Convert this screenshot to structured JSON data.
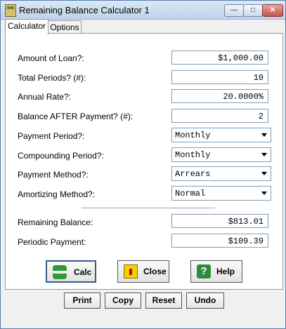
{
  "window": {
    "title": "Remaining Balance Calculator 1"
  },
  "tabs": [
    {
      "label": "Calculator"
    },
    {
      "label": "Options"
    }
  ],
  "inputs": {
    "amount_of_loan": {
      "label": "Amount of Loan?:",
      "value": "$1,000.00"
    },
    "total_periods": {
      "label": "Total Periods? (#):",
      "value": "10"
    },
    "annual_rate": {
      "label": "Annual Rate?:",
      "value": "20.0000%"
    },
    "balance_after_payment": {
      "label": "Balance AFTER Payment? (#):",
      "value": "2"
    }
  },
  "selects": {
    "payment_period": {
      "label": "Payment Period?:",
      "value": "Monthly"
    },
    "compounding_period": {
      "label": "Compounding Period?:",
      "value": "Monthly"
    },
    "payment_method": {
      "label": "Payment Method?:",
      "value": "Arrears"
    },
    "amortizing_method": {
      "label": "Amortizing Method?:",
      "value": "Normal"
    }
  },
  "results": {
    "remaining_balance": {
      "label": "Remaining Balance:",
      "value": "$813.01"
    },
    "periodic_payment": {
      "label": "Periodic Payment:",
      "value": "$109.39"
    }
  },
  "buttons": {
    "calc": "Calc",
    "close": "Close",
    "help": "Help",
    "print": "Print",
    "copy": "Copy",
    "reset": "Reset",
    "undo": "Undo"
  },
  "icons": {
    "app": "calculator-icon",
    "calc": "calc-icon",
    "close": "door-icon",
    "help": "help-icon"
  },
  "colors": {
    "accent": "#3a5a8a",
    "close_button": "#c75050"
  }
}
